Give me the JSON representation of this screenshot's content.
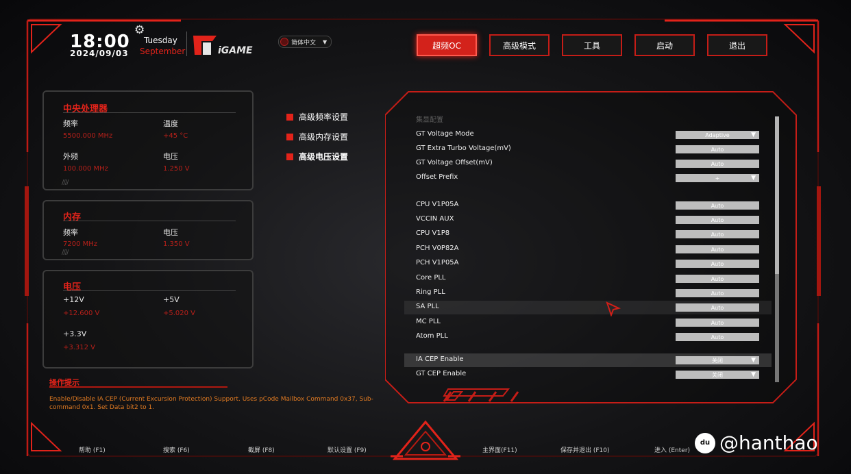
{
  "header": {
    "time": "18:00",
    "date": "2024/09/03",
    "day": "Tuesday",
    "month": "September",
    "logo_text": "iGAME",
    "language": "简体中文",
    "language_arrow": "▼"
  },
  "nav": {
    "tabs": [
      "超频OC",
      "高级模式",
      "工具",
      "启动",
      "退出"
    ],
    "active_index": 0
  },
  "info": {
    "cpu": {
      "title": "中央处理器",
      "freq_label": "频率",
      "freq_value": "5500.000 MHz",
      "temp_label": "温度",
      "temp_value": "+45 °C",
      "bclk_label": "外频",
      "bclk_value": "100.000 MHz",
      "volt_label": "电压",
      "volt_value": "1.250 V"
    },
    "memory": {
      "title": "内存",
      "freq_label": "频率",
      "freq_value": "7200 MHz",
      "volt_label": "电压",
      "volt_value": "1.350 V"
    },
    "voltage": {
      "title": "电压",
      "v12_label": "+12V",
      "v12_value": "+12.600 V",
      "v5_label": "+5V",
      "v5_value": "+5.020 V",
      "v33_label": "+3.3V",
      "v33_value": "+3.312 V"
    }
  },
  "menu": [
    "高级频率设置",
    "高级内存设置",
    "高级电压设置"
  ],
  "settings": {
    "section": "集显配置",
    "rows": [
      {
        "label": "GT Voltage Mode",
        "value": "Adaptive",
        "dropdown": true
      },
      {
        "label": "GT Extra Turbo Voltage(mV)",
        "value": "Auto"
      },
      {
        "label": "GT Voltage Offset(mV)",
        "value": "Auto"
      },
      {
        "label": "Offset Prefix",
        "value": "+",
        "dropdown": true
      },
      {
        "label": "CPU V1P05A",
        "value": "Auto"
      },
      {
        "label": "VCCIN AUX",
        "value": "Auto"
      },
      {
        "label": "CPU V1P8",
        "value": "Auto"
      },
      {
        "label": "PCH V0P82A",
        "value": "Auto"
      },
      {
        "label": "PCH V1P05A",
        "value": "Auto"
      },
      {
        "label": "Core PLL",
        "value": "Auto"
      },
      {
        "label": "Ring PLL",
        "value": "Auto"
      },
      {
        "label": "SA PLL",
        "value": "Auto"
      },
      {
        "label": "MC PLL",
        "value": "Auto"
      },
      {
        "label": "Atom PLL",
        "value": "Auto"
      },
      {
        "label": "IA CEP Enable",
        "value": "关闭",
        "dropdown": true
      },
      {
        "label": "GT CEP Enable",
        "value": "关闭",
        "dropdown": true
      }
    ]
  },
  "help": {
    "title": "操作提示",
    "text": "Enable/Disable IA CEP (Current Excursion Protection) Support. Uses pCode Mailbox Command 0x37, Sub-command 0x1. Set Data bit2 to 1."
  },
  "footer": [
    "帮助 (F1)",
    "搜索 (F6)",
    "截屏 (F8)",
    "默认设置 (F9)",
    "主界面(F11)",
    "保存并退出 (F10)",
    "进入 (Enter)"
  ],
  "watermark": {
    "icon": "du",
    "text": "@hanthao"
  },
  "colors": {
    "accent": "#e2231a",
    "panel_border": "#3c3c3c",
    "help_text": "#e07a22"
  },
  "icons": [
    "gear-icon",
    "globe-icon",
    "mouse-cursor-icon",
    "triangle-emblem-icon"
  ]
}
